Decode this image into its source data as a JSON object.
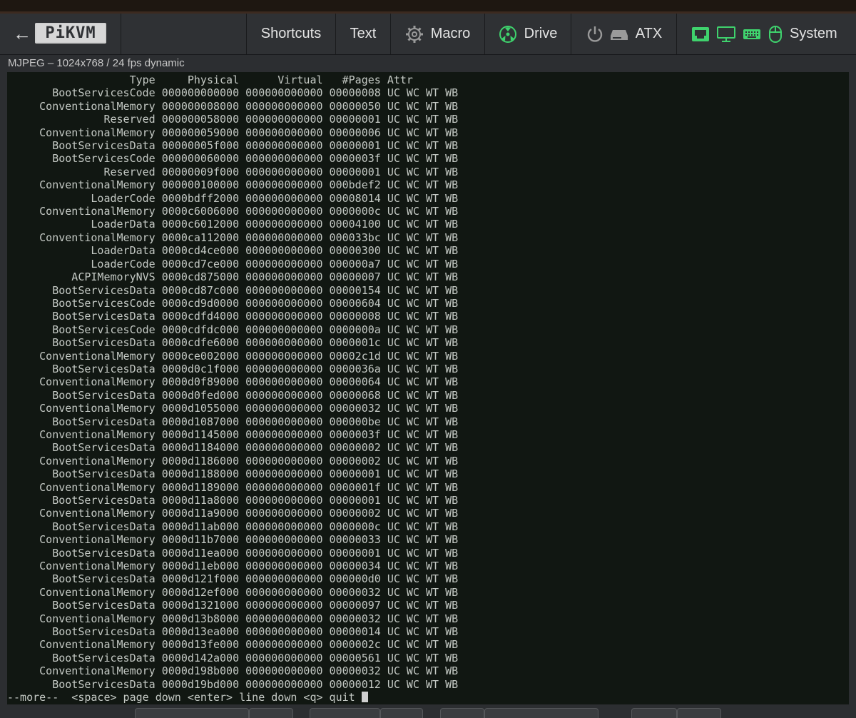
{
  "navbar": {
    "back_icon": "arrow-left-icon",
    "logo_text": "PiKVM",
    "shortcuts_label": "Shortcuts",
    "text_label": "Text",
    "macro_label": "Macro",
    "drive_label": "Drive",
    "atx_label": "ATX",
    "system_label": "System",
    "accent_color": "#3fd26d"
  },
  "stream": {
    "info": "MJPEG – 1024x768 / 24 fps dynamic"
  },
  "terminal": {
    "header": [
      "Type",
      "Physical",
      "Virtual",
      "#Pages",
      "Attr"
    ],
    "rows": [
      [
        "BootServicesCode",
        "000000000000",
        "000000000000",
        "00000008",
        "UC WC WT WB"
      ],
      [
        "ConventionalMemory",
        "000000008000",
        "000000000000",
        "00000050",
        "UC WC WT WB"
      ],
      [
        "Reserved",
        "000000058000",
        "000000000000",
        "00000001",
        "UC WC WT WB"
      ],
      [
        "ConventionalMemory",
        "000000059000",
        "000000000000",
        "00000006",
        "UC WC WT WB"
      ],
      [
        "BootServicesData",
        "00000005f000",
        "000000000000",
        "00000001",
        "UC WC WT WB"
      ],
      [
        "BootServicesCode",
        "000000060000",
        "000000000000",
        "0000003f",
        "UC WC WT WB"
      ],
      [
        "Reserved",
        "00000009f000",
        "000000000000",
        "00000001",
        "UC WC WT WB"
      ],
      [
        "ConventionalMemory",
        "000000100000",
        "000000000000",
        "000bdef2",
        "UC WC WT WB"
      ],
      [
        "LoaderCode",
        "0000bdff2000",
        "000000000000",
        "00008014",
        "UC WC WT WB"
      ],
      [
        "ConventionalMemory",
        "0000c6006000",
        "000000000000",
        "0000000c",
        "UC WC WT WB"
      ],
      [
        "LoaderData",
        "0000c6012000",
        "000000000000",
        "00004100",
        "UC WC WT WB"
      ],
      [
        "ConventionalMemory",
        "0000ca112000",
        "000000000000",
        "000033bc",
        "UC WC WT WB"
      ],
      [
        "LoaderData",
        "0000cd4ce000",
        "000000000000",
        "00000300",
        "UC WC WT WB"
      ],
      [
        "LoaderCode",
        "0000cd7ce000",
        "000000000000",
        "000000a7",
        "UC WC WT WB"
      ],
      [
        "ACPIMemoryNVS",
        "0000cd875000",
        "000000000000",
        "00000007",
        "UC WC WT WB"
      ],
      [
        "BootServicesData",
        "0000cd87c000",
        "000000000000",
        "00000154",
        "UC WC WT WB"
      ],
      [
        "BootServicesCode",
        "0000cd9d0000",
        "000000000000",
        "00000604",
        "UC WC WT WB"
      ],
      [
        "BootServicesData",
        "0000cdfd4000",
        "000000000000",
        "00000008",
        "UC WC WT WB"
      ],
      [
        "BootServicesCode",
        "0000cdfdc000",
        "000000000000",
        "0000000a",
        "UC WC WT WB"
      ],
      [
        "BootServicesData",
        "0000cdfe6000",
        "000000000000",
        "0000001c",
        "UC WC WT WB"
      ],
      [
        "ConventionalMemory",
        "0000ce002000",
        "000000000000",
        "00002c1d",
        "UC WC WT WB"
      ],
      [
        "BootServicesData",
        "0000d0c1f000",
        "000000000000",
        "0000036a",
        "UC WC WT WB"
      ],
      [
        "ConventionalMemory",
        "0000d0f89000",
        "000000000000",
        "00000064",
        "UC WC WT WB"
      ],
      [
        "BootServicesData",
        "0000d0fed000",
        "000000000000",
        "00000068",
        "UC WC WT WB"
      ],
      [
        "ConventionalMemory",
        "0000d1055000",
        "000000000000",
        "00000032",
        "UC WC WT WB"
      ],
      [
        "BootServicesData",
        "0000d1087000",
        "000000000000",
        "000000be",
        "UC WC WT WB"
      ],
      [
        "ConventionalMemory",
        "0000d1145000",
        "000000000000",
        "0000003f",
        "UC WC WT WB"
      ],
      [
        "BootServicesData",
        "0000d1184000",
        "000000000000",
        "00000002",
        "UC WC WT WB"
      ],
      [
        "ConventionalMemory",
        "0000d1186000",
        "000000000000",
        "00000002",
        "UC WC WT WB"
      ],
      [
        "BootServicesData",
        "0000d1188000",
        "000000000000",
        "00000001",
        "UC WC WT WB"
      ],
      [
        "ConventionalMemory",
        "0000d1189000",
        "000000000000",
        "0000001f",
        "UC WC WT WB"
      ],
      [
        "BootServicesData",
        "0000d11a8000",
        "000000000000",
        "00000001",
        "UC WC WT WB"
      ],
      [
        "ConventionalMemory",
        "0000d11a9000",
        "000000000000",
        "00000002",
        "UC WC WT WB"
      ],
      [
        "BootServicesData",
        "0000d11ab000",
        "000000000000",
        "0000000c",
        "UC WC WT WB"
      ],
      [
        "ConventionalMemory",
        "0000d11b7000",
        "000000000000",
        "00000033",
        "UC WC WT WB"
      ],
      [
        "BootServicesData",
        "0000d11ea000",
        "000000000000",
        "00000001",
        "UC WC WT WB"
      ],
      [
        "ConventionalMemory",
        "0000d11eb000",
        "000000000000",
        "00000034",
        "UC WC WT WB"
      ],
      [
        "BootServicesData",
        "0000d121f000",
        "000000000000",
        "000000d0",
        "UC WC WT WB"
      ],
      [
        "ConventionalMemory",
        "0000d12ef000",
        "000000000000",
        "00000032",
        "UC WC WT WB"
      ],
      [
        "BootServicesData",
        "0000d1321000",
        "000000000000",
        "00000097",
        "UC WC WT WB"
      ],
      [
        "ConventionalMemory",
        "0000d13b8000",
        "000000000000",
        "00000032",
        "UC WC WT WB"
      ],
      [
        "BootServicesData",
        "0000d13ea000",
        "000000000000",
        "00000014",
        "UC WC WT WB"
      ],
      [
        "ConventionalMemory",
        "0000d13fe000",
        "000000000000",
        "0000002c",
        "UC WC WT WB"
      ],
      [
        "BootServicesData",
        "0000d142a000",
        "000000000000",
        "00000561",
        "UC WC WT WB"
      ],
      [
        "ConventionalMemory",
        "0000d198b000",
        "000000000000",
        "00000032",
        "UC WC WT WB"
      ],
      [
        "BootServicesData",
        "0000d19bd000",
        "000000000000",
        "00000012",
        "UC WC WT WB"
      ]
    ],
    "pager": "--more--  <space> page down <enter> line down <q> quit "
  }
}
